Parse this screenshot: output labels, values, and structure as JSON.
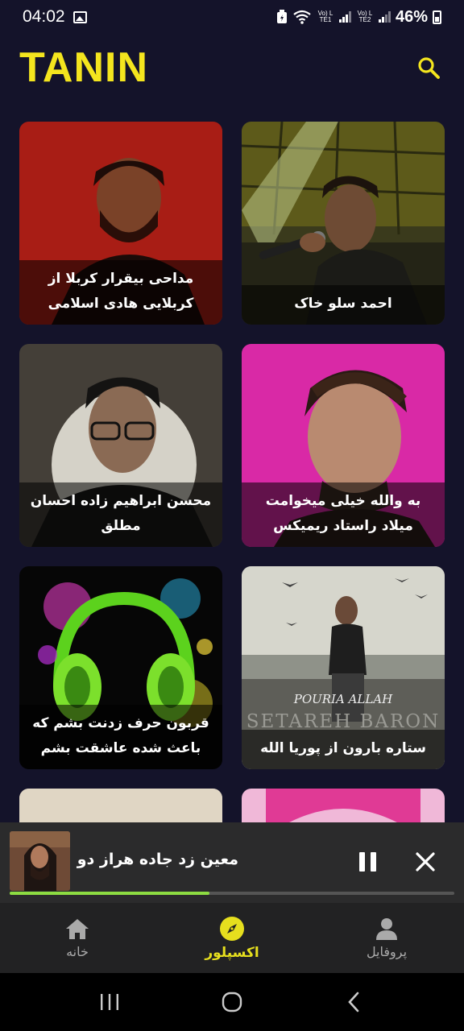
{
  "status_bar": {
    "time": "04:02",
    "sim1": "Vo) LTE1",
    "sim2": "Vo) LTE2",
    "battery": "46%"
  },
  "header": {
    "logo": "TANIN",
    "search_icon": "search-icon"
  },
  "cards": [
    {
      "caption": "احمد سلو خاک"
    },
    {
      "caption": "مداحی بیقرار کربلا از کربلایی هادی اسلامی"
    },
    {
      "caption": "به والله خیلی میخوامت میلاد راستاد ریمیکس"
    },
    {
      "caption": "محسن ابراهیم زاده احسان مطلق"
    },
    {
      "caption": "ستاره بارون از پوریا الله"
    },
    {
      "caption": "قربون حرف زدنت بشم که باعث شده عاشقت بشم"
    }
  ],
  "artwork_text": {
    "setareh_artist": "POURIA ALLAH",
    "setareh_title": "SETAREH BARON"
  },
  "mini_player": {
    "title": "معین زد جاده هراز دو",
    "progress": 0.45
  },
  "bottom_nav": {
    "items": [
      {
        "label": "پروفایل",
        "icon": "person-icon"
      },
      {
        "label": "اکسپلور",
        "icon": "compass-icon",
        "active": true
      },
      {
        "label": "خانه",
        "icon": "home-icon"
      }
    ]
  },
  "colors": {
    "background": "#14132a",
    "accent": "#f4e51e",
    "progress": "#8ddc42"
  }
}
